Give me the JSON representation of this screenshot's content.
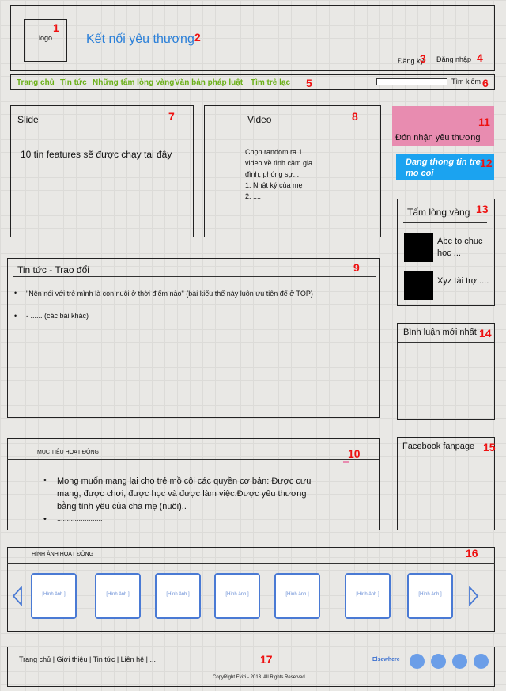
{
  "markers": {
    "n1": "1",
    "n2": "2",
    "n3": "3",
    "n4": "4",
    "n5": "5",
    "n6": "6",
    "n7": "7",
    "n8": "8",
    "n9": "9",
    "n10": "10",
    "n11": "11",
    "n12": "12",
    "n13": "13",
    "n14": "14",
    "n15": "15",
    "n16": "16",
    "n17": "17"
  },
  "header": {
    "logo": "logo",
    "site_title": "Kết nối yêu thương",
    "register": "Đăng ký",
    "login": "Đăng nhập"
  },
  "nav": {
    "items": [
      "Trang chủ",
      "Tin tức",
      "Những tấm lòng vàng",
      "Văn bản pháp luật",
      "Tìm  trẻ lạc"
    ],
    "search_label": "Tìm kiếm",
    "link_color": "#6ab018"
  },
  "slide": {
    "title": "Slide",
    "body": "10 tin features sẽ được chạy tại đây"
  },
  "video": {
    "title": "Video",
    "lines": [
      "Chọn random ra 1",
      "video về tình cảm gia",
      "đình, phóng sự...",
      "1. Nhật ký của mẹ",
      "2. ...."
    ]
  },
  "news": {
    "title": "Tin tức - Trao đổi",
    "items": [
      "\"Nên nói với trẻ mình là con nuôi ở thời điểm nào\" (bài kiểu thế này luôn ưu tiên để ở TOP)",
      "- ...... (các bài khác)"
    ]
  },
  "goals": {
    "title": "MỤC TIÊU HOẠT ĐỘNG",
    "items": [
      "Mong muốn mang lại cho trẻ mồ côi các quyền cơ bản: Được cưu mang, được chơi, được học và được làm việc.Được yêu thương bằng tình yêu của cha mẹ (nuôi)..",
      "......................."
    ]
  },
  "sidebar": {
    "receive_love": "Đón nhận yêu thương",
    "receive_color": "#e88cb0",
    "orphan_info": "Dang thong tin tre mo coi",
    "orphan_color": "#1ba3f0",
    "golden_hearts": {
      "title": "Tấm lòng vàng",
      "items": [
        "Abc to chuc hoc ...",
        "Xyz tài trợ....."
      ]
    },
    "latest_comments": "Bình luận mới nhất",
    "facebook": "Facebook  fanpage"
  },
  "gallery": {
    "title": "HÌNH ẢNH HOẠT ĐỘNG",
    "image_label": "[Hình ảnh ]",
    "prev_icon": "chevron-left-icon",
    "next_icon": "chevron-right-icon",
    "accent": "#4a7ad4"
  },
  "footer": {
    "links": "Trang chủ | Giới thiệu | Tin tức | Liên hệ | ...",
    "elsewhere": "Elsewhere",
    "copyright": "CopyRight Evizi - 2013. All Rights Reserved"
  }
}
